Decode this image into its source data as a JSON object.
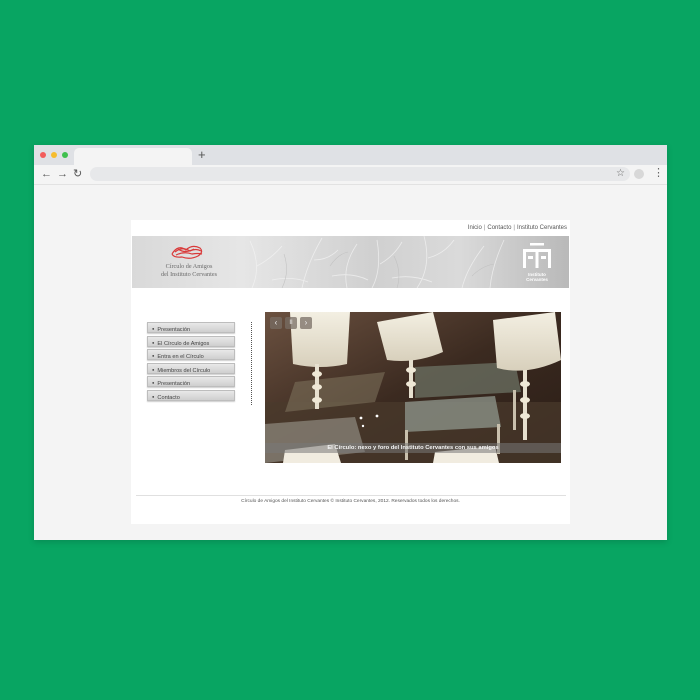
{
  "browser": {
    "new_tab_label": "+",
    "back_icon": "←",
    "forward_icon": "→",
    "reload_icon": "↻",
    "star_icon": "☆",
    "menu_icon": "⋮"
  },
  "header": {
    "links": [
      "Inicio",
      "Contacto",
      "Instituto Cervantes"
    ],
    "separator": "|",
    "logo_line1": "Círculo de Amigos",
    "logo_line2": "del Instituto Cervantes",
    "ic_line1": "Instituto",
    "ic_line2": "Cervantes"
  },
  "menu": {
    "items": [
      {
        "label": "Presentación"
      },
      {
        "label": "El Círculo de Amigos"
      },
      {
        "label": "Entra en el Círculo"
      },
      {
        "label": "Miembros del Círculo"
      },
      {
        "label": "Presentación"
      },
      {
        "label": "Contacto"
      }
    ]
  },
  "slideshow": {
    "prev_icon": "‹",
    "pause_icon": "II",
    "next_icon": "›",
    "caption": "El Círculo: nexo y foro del Instituto Cervantes con sus amigos"
  },
  "footer": {
    "text": "Círculo de Amigos del Instituto Cervantes © Instituto Cervantes, 2012. Reservados todos los derechos."
  },
  "colors": {
    "background": "#08a562",
    "browser_chrome": "#dfe1e5",
    "logo_red": "#d93a3a"
  }
}
